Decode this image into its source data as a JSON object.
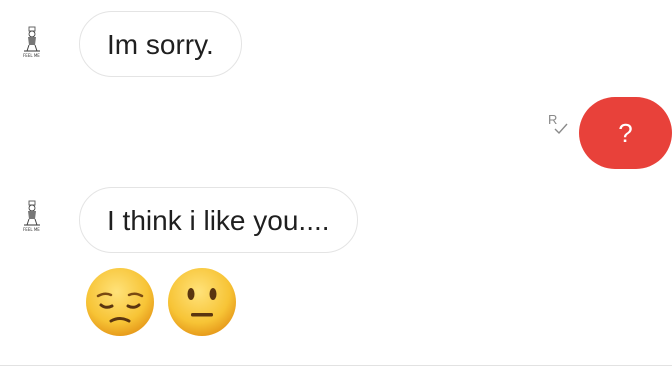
{
  "messages": [
    {
      "direction": "incoming",
      "text": "Im sorry."
    },
    {
      "direction": "outgoing",
      "text": "?",
      "receipt": "R"
    },
    {
      "direction": "incoming",
      "text": "I think i like you...."
    },
    {
      "direction": "incoming",
      "emoji": [
        "pensive-face",
        "neutral-face"
      ]
    }
  ],
  "colors": {
    "outgoing_bubble": "#e8413a",
    "incoming_border": "#e4e4e4",
    "emoji_yellow": "#f7c436"
  }
}
